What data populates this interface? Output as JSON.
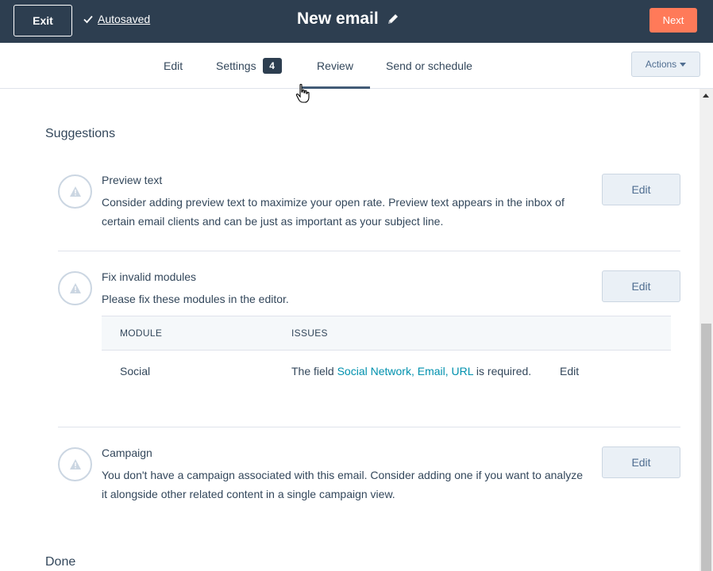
{
  "header": {
    "exit_label": "Exit",
    "autosaved_label": "Autosaved",
    "title": "New email",
    "next_label": "Next"
  },
  "tabs": {
    "edit": "Edit",
    "settings": "Settings",
    "settings_badge": "4",
    "review": "Review",
    "send": "Send or schedule",
    "active": "Review"
  },
  "actions_label": "Actions",
  "suggestions_heading": "Suggestions",
  "suggestions": [
    {
      "title": "Preview text",
      "description": "Consider adding preview text to maximize your open rate. Preview text appears in the inbox of certain email clients and can be just as important as your subject line.",
      "button": "Edit"
    },
    {
      "title": "Fix invalid modules",
      "description": "Please fix these modules in the editor.",
      "button": "Edit"
    },
    {
      "title": "Campaign",
      "description": "You don't have a campaign associated with this email. Consider adding one if you want to analyze it alongside other related content in a single campaign view.",
      "button": "Edit"
    }
  ],
  "module_table": {
    "col_module": "MODULE",
    "col_issues": "ISSUES",
    "rows": [
      {
        "module": "Social",
        "issue_prefix": "The field ",
        "issue_fields": "Social Network, Email, URL",
        "issue_suffix": " is required.",
        "action": "Edit"
      }
    ]
  },
  "done_heading": "Done",
  "colors": {
    "header_bg": "#2d3e50",
    "next_button": "#ff7a59",
    "link": "#0091ae",
    "text": "#33475b",
    "button_bg": "#eaf0f6"
  }
}
